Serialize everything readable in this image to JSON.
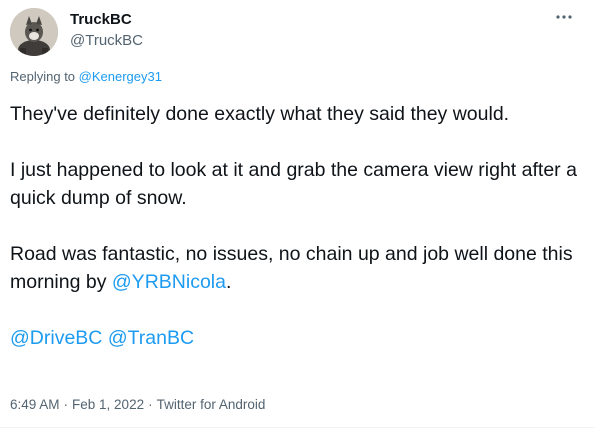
{
  "author": {
    "display_name": "TruckBC",
    "handle": "@TruckBC",
    "avatar_icon": "profile-avatar-icon"
  },
  "more_icon": "more-options-icon",
  "replying": {
    "prefix": "Replying to",
    "mention": "@Kenergey31"
  },
  "tweet": {
    "paragraph1": "They've definitely done exactly what they said they would.",
    "paragraph2": "I just happened to look at it and grab the camera view right after a quick dump of snow.",
    "paragraph3_text": "Road was fantastic, no issues, no chain up and job well done this morning by",
    "paragraph3_mention": "@YRBNicola",
    "paragraph3_end": ".",
    "mention_drivebc": "@DriveBC",
    "mention_tranbc": "@TranBC"
  },
  "meta": {
    "time": "6:49 AM",
    "date": "Feb 1, 2022",
    "source": "Twitter for Android",
    "separator": "·"
  },
  "colors": {
    "link": "#1d9bf0",
    "secondary_text": "#536471",
    "primary_text": "#0f1419"
  }
}
